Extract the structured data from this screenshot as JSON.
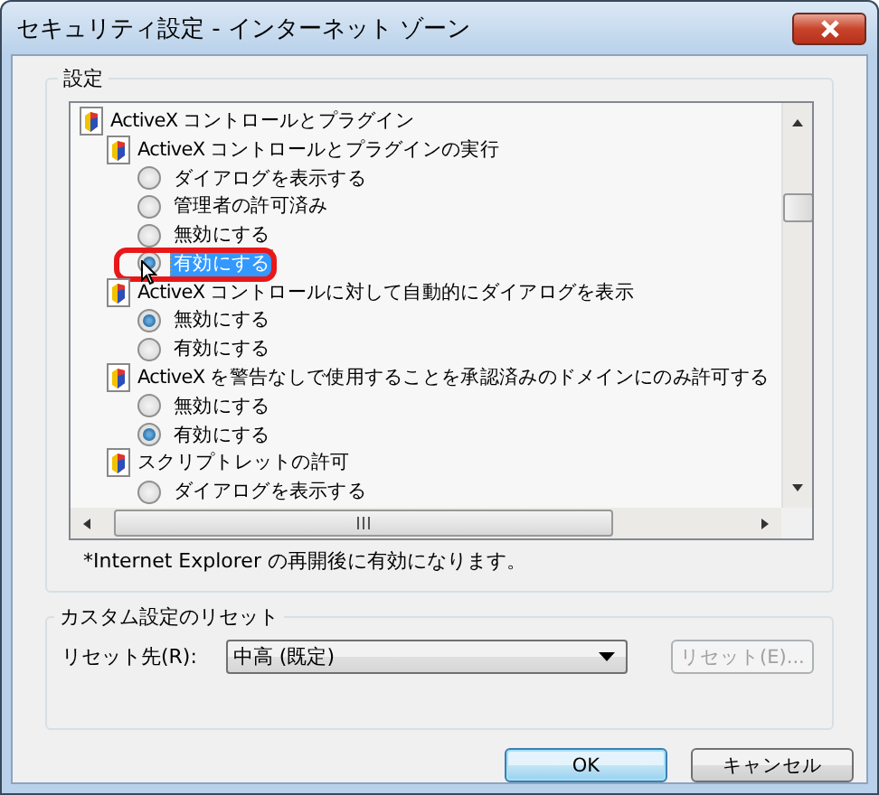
{
  "window": {
    "title": "セキュリティ設定 - インターネット ゾーン"
  },
  "settings": {
    "title": "設定",
    "items": [
      {
        "label": "ActiveX コントロールとプラグイン",
        "children": [
          {
            "label": "ActiveX コントロールとプラグインの実行",
            "options": [
              {
                "label": "ダイアログを表示する",
                "selected": false,
                "focused": false,
                "circled": false
              },
              {
                "label": "管理者の許可済み",
                "selected": false,
                "focused": false,
                "circled": false
              },
              {
                "label": "無効にする",
                "selected": false,
                "focused": false,
                "circled": false
              },
              {
                "label": "有効にする",
                "selected": true,
                "focused": true,
                "circled": true
              }
            ]
          },
          {
            "label": "ActiveX コントロールに対して自動的にダイアログを表示",
            "options": [
              {
                "label": "無効にする",
                "selected": true,
                "focused": false,
                "circled": false
              },
              {
                "label": "有効にする",
                "selected": false,
                "focused": false,
                "circled": false
              }
            ]
          },
          {
            "label": "ActiveX を警告なしで使用することを承認済みのドメインにのみ許可する",
            "options": [
              {
                "label": "無効にする",
                "selected": false,
                "focused": false,
                "circled": false
              },
              {
                "label": "有効にする",
                "selected": true,
                "focused": false,
                "circled": false
              }
            ]
          },
          {
            "label": "スクリプトレットの許可",
            "options": [
              {
                "label": "ダイアログを表示する",
                "selected": false,
                "focused": false,
                "circled": false
              }
            ]
          }
        ]
      }
    ],
    "note": "*Internet Explorer の再開後に有効になります。"
  },
  "reset": {
    "title": "カスタム設定のリセット",
    "label": "リセット先(R):",
    "value": "中高 (既定)",
    "button": {
      "label": "リセット(E)...",
      "disabled": true
    }
  },
  "buttons": [
    {
      "label": "OK",
      "default": true
    },
    {
      "label": "キャンセル",
      "default": false
    }
  ]
}
